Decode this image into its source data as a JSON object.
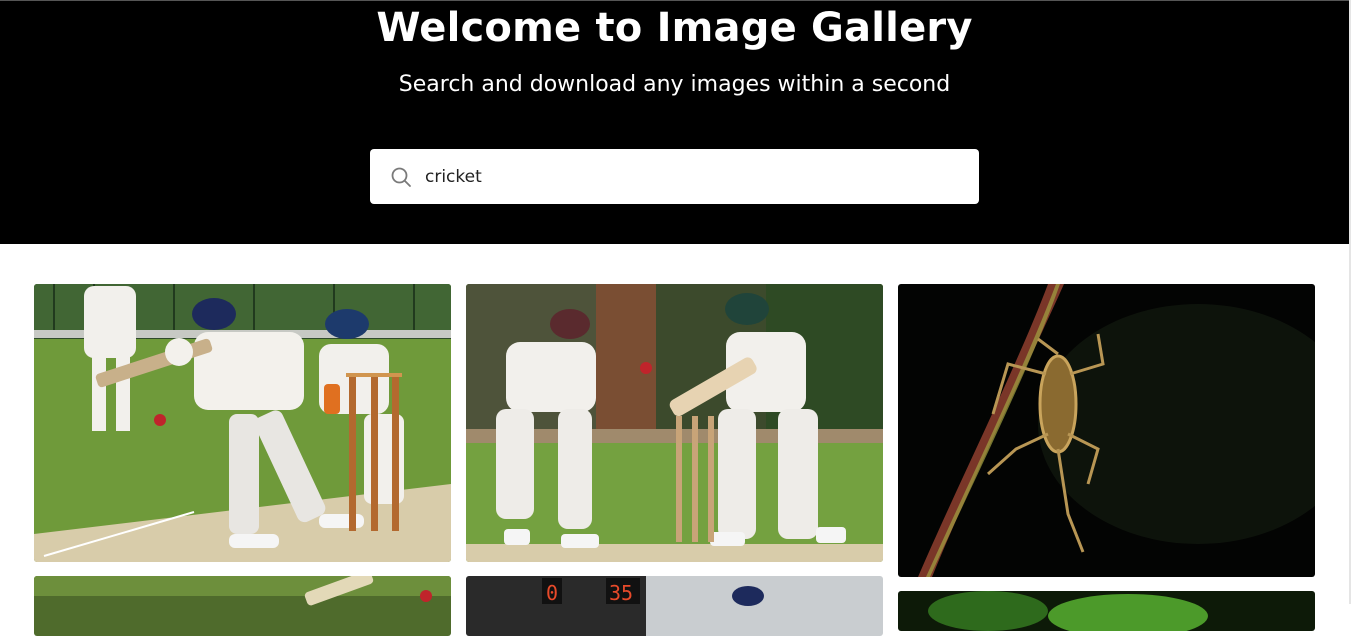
{
  "hero": {
    "title": "Welcome to Image Gallery",
    "subtitle": "Search and download any images within a second"
  },
  "search": {
    "value": "cricket",
    "icon": "search-icon"
  },
  "gallery": {
    "images": [
      {
        "subject": "cricket batsman and wicketkeeper on green field"
      },
      {
        "subject": "cricket batsman swinging at ball near stumps"
      },
      {
        "subject": "insect on a red stem against dark background"
      },
      {
        "subject": "cricket batsman"
      },
      {
        "subject": "cricket scoreboard"
      },
      {
        "subject": "green foliage"
      }
    ]
  },
  "colors": {
    "hero_bg": "#000000",
    "text_on_hero": "#ffffff",
    "field_green": "#6f9a3a",
    "pitch": "#d8ccaa"
  }
}
